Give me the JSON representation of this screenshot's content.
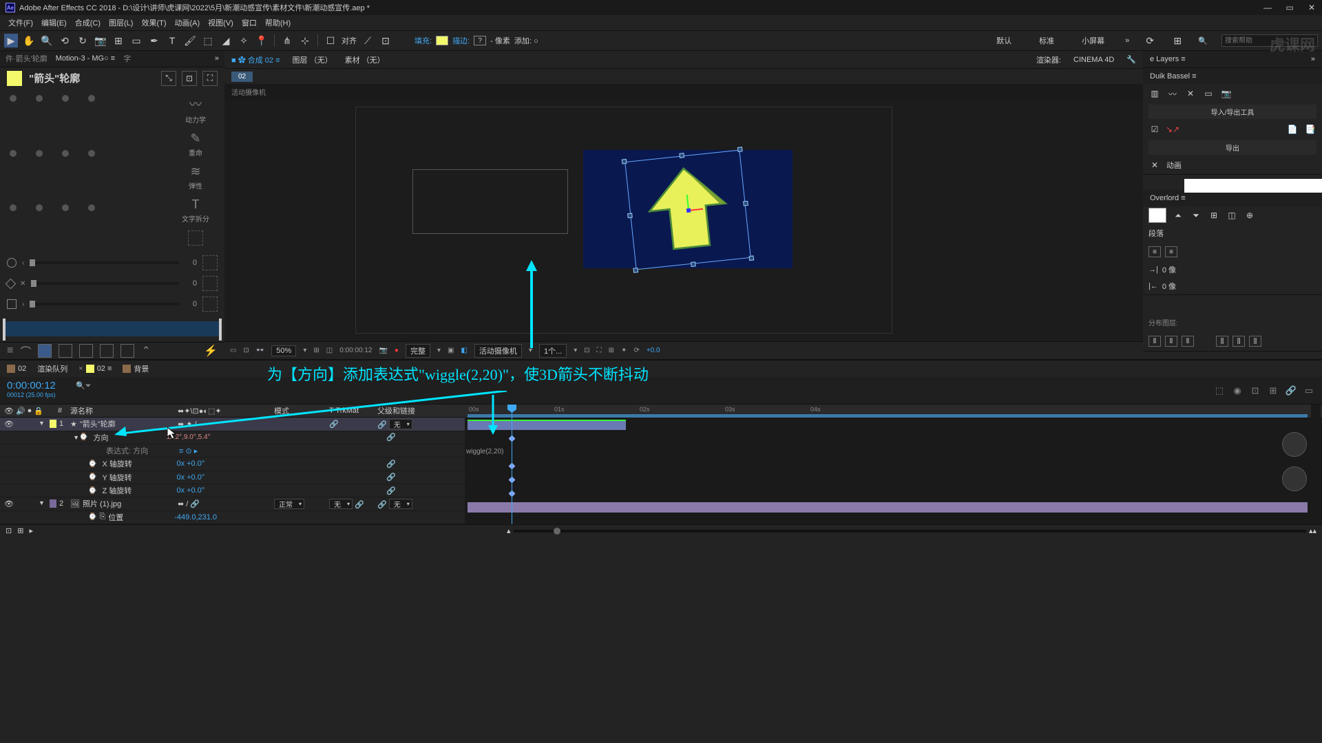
{
  "titlebar": {
    "app_icon": "Ae",
    "title": "Adobe After Effects CC 2018 - D:\\设计\\讲师\\虎课网\\2022\\5月\\新潮动感宣传\\素材文件\\新潮动感宣传.aep *"
  },
  "menubar": [
    "文件(F)",
    "编辑(E)",
    "合成(C)",
    "图层(L)",
    "效果(T)",
    "动画(A)",
    "视图(V)",
    "窗口",
    "帮助(H)"
  ],
  "toolbar": {
    "snap_label": "对齐",
    "fill_label": "填充:",
    "stroke_label": "描边:",
    "stroke_px": "- 像素",
    "add_label": "添加: ○",
    "workspaces": [
      "默认",
      "标准",
      "小屏幕"
    ],
    "search_placeholder": "搜索帮助"
  },
  "left_panel": {
    "tabs_left": "件·箭头'轮廓",
    "tabs_mid": "Motion-3 - MG○  ≡",
    "tabs_right": "字",
    "layer_name": "\"箭头\"轮廓",
    "motion_items": [
      {
        "icon": "〰",
        "label": "动力学"
      },
      {
        "icon": "✎",
        "label": "重命"
      },
      {
        "icon": "≋",
        "label": "弹性"
      },
      {
        "icon": "T",
        "label": "文字拆分"
      }
    ],
    "slider_vals": [
      "0",
      "0",
      "0"
    ]
  },
  "center": {
    "tabs": [
      "■ ✿ 合成 02 ≡",
      "图层 （无）",
      "素材 （无）"
    ],
    "comp_tab": "02",
    "camera": "活动摄像机",
    "renderer_label": "渲染器:",
    "renderer_value": "CINEMA 4D",
    "bottom": {
      "zoom": "50%",
      "timecode": "0:00:00:12",
      "quality": "完整",
      "camera": "活动摄像机",
      "views": "1个...",
      "exposure": "+0.0"
    }
  },
  "right_panel": {
    "layers_tab": "e Layers  ≡",
    "duik_tab": "Duik Bassel  ≡",
    "import_export": "导入/导出工具",
    "export": "导出",
    "anim": "动画",
    "overlord": "Overlord  ≡",
    "paragraph": "段落",
    "indent1": "0 像",
    "indent2": "0 像",
    "distribute": "分布图层:"
  },
  "timeline": {
    "tabs": [
      {
        "icon": "■",
        "label": "02"
      },
      {
        "icon": "",
        "label": "渲染队列"
      },
      {
        "icon": "■",
        "label": "02 ≡",
        "active": true
      },
      {
        "icon": "■",
        "label": "背景"
      }
    ],
    "annotation": "为【方向】添加表达式\"wiggle(2,20)\"，使3D箭头不断抖动",
    "timecode": "0:00:00:12",
    "fps": "00012 (25.00 fps)",
    "cols": {
      "idx": "#",
      "name": "源名称",
      "mode": "模式",
      "trk": "T  TrkMat",
      "parent": "父级和链接"
    },
    "layers": [
      {
        "idx": "1",
        "name": "\"箭头\"轮廓",
        "props": [
          {
            "indent": 1,
            "twirl": "▼",
            "stopwatch": "⌚",
            "name": "方向",
            "val": "11.2°,9.0°,5.4°",
            "red": true
          },
          {
            "indent": 2,
            "name": "表达式: 方向",
            "icons": "≡  ⊙ ▸"
          },
          {
            "indent": 1,
            "stopwatch": "⌚",
            "name": "X 轴旋转",
            "val": "0x +0.0°"
          },
          {
            "indent": 1,
            "stopwatch": "⌚",
            "name": "Y 轴旋转",
            "val": "0x +0.0°"
          },
          {
            "indent": 1,
            "stopwatch": "⌚",
            "name": "Z 轴旋转",
            "val": "0x +0.0°"
          }
        ]
      },
      {
        "idx": "2",
        "name": "照片 (1).jpg",
        "mode": "正常",
        "trk": "无",
        "parent": "无",
        "props": [
          {
            "indent": 1,
            "stopwatch": "⌚",
            "lock": "⎘",
            "name": "位置",
            "val": "-449.0,231.0"
          }
        ]
      }
    ],
    "ruler": [
      "00s",
      "01s",
      "02s",
      "03s",
      "04s"
    ],
    "expression": "wiggle(2,20)",
    "none_label": "无"
  },
  "watermark": "虎课网"
}
